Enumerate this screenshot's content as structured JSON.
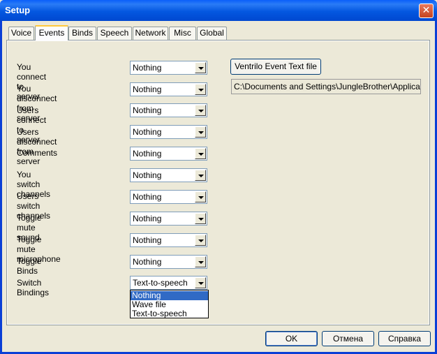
{
  "window": {
    "title": "Setup",
    "close_glyph": "✕"
  },
  "tabs": [
    {
      "label": "Voice"
    },
    {
      "label": "Events",
      "active": true
    },
    {
      "label": "Binds"
    },
    {
      "label": "Speech"
    },
    {
      "label": "Network"
    },
    {
      "label": "Misc"
    },
    {
      "label": "Global"
    }
  ],
  "events": [
    {
      "label": "You connect to server",
      "value": "Nothing"
    },
    {
      "label": "You disconnect from server",
      "value": "Nothing"
    },
    {
      "label": "Users connect to server",
      "value": "Nothing"
    },
    {
      "label": "Users disconnect from server",
      "value": "Nothing"
    },
    {
      "label": "Comments",
      "value": "Nothing"
    },
    {
      "label": "You switch channels",
      "value": "Nothing"
    },
    {
      "label": "Users switch channels",
      "value": "Nothing"
    },
    {
      "label": "Toggle mute sound",
      "value": "Nothing"
    },
    {
      "label": "Toggle mute microphone",
      "value": "Nothing"
    },
    {
      "label": "Toggle Binds",
      "value": "Nothing"
    },
    {
      "label": "Switch Bindings",
      "value": "Text-to-speech"
    }
  ],
  "dropdown_options": [
    "Nothing",
    "Wave file",
    "Text-to-speech"
  ],
  "dropdown_selected": "Nothing",
  "event_text_file": {
    "button_label": "Ventrilo Event Text file",
    "path": "C:\\Documents and Settings\\JungleBrother\\Application"
  },
  "footer": {
    "ok": "OK",
    "cancel": "Отмена",
    "help": "Справка"
  },
  "colors": {
    "titlebar": "#0457E0",
    "selection": "#316AC5",
    "face": "#ECE9D8",
    "tab_highlight": "#FFC83C"
  }
}
